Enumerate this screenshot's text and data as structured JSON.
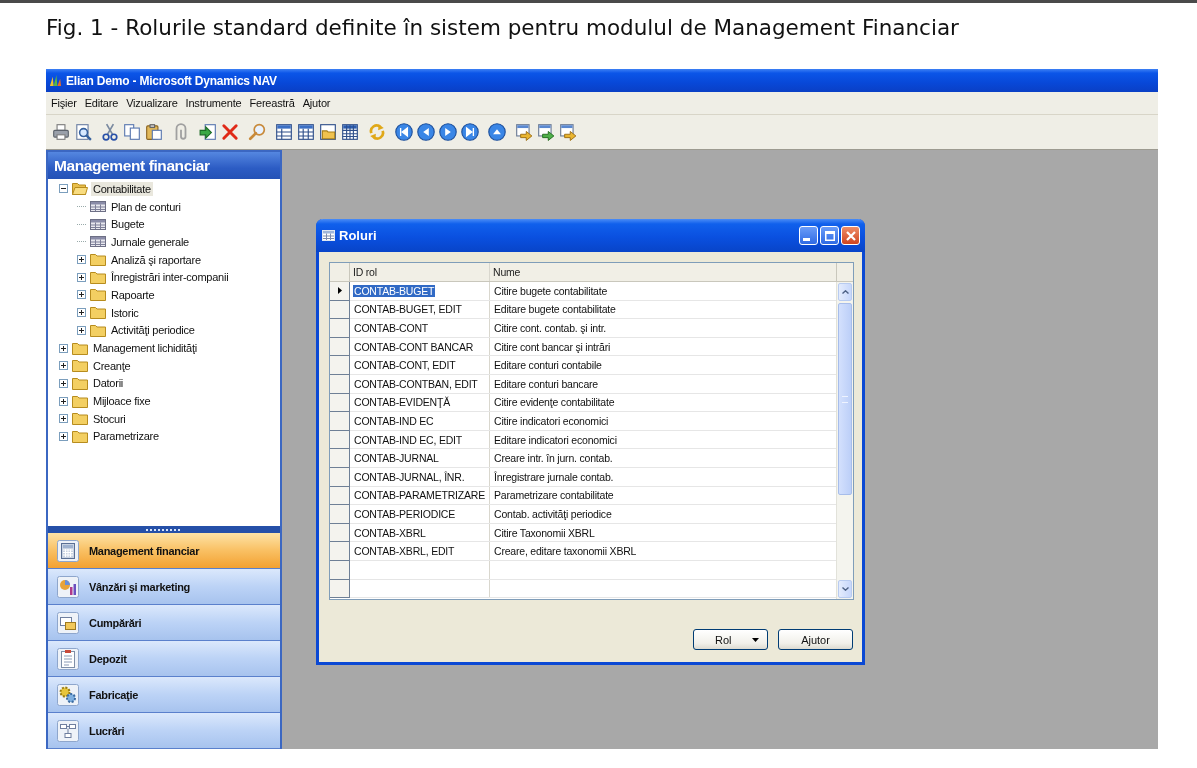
{
  "caption": "Fig. 1 - Rolurile standard definite în sistem pentru modulul de Management Financiar",
  "window": {
    "title": "Elian Demo - Microsoft Dynamics NAV"
  },
  "menu_bar": [
    "Fişier",
    "Editare",
    "Vizualizare",
    "Instrumente",
    "Fereastră",
    "Ajutor"
  ],
  "navigation_pane": {
    "title": "Management financiar",
    "tree": [
      {
        "label": "Contabilitate",
        "kind": "folder",
        "expanded": true,
        "selected": true,
        "children": [
          {
            "label": "Plan de conturi",
            "kind": "table",
            "expanded": false,
            "selected": false
          },
          {
            "label": "Bugete",
            "kind": "table",
            "expanded": false,
            "selected": false
          },
          {
            "label": "Jurnale generale",
            "kind": "table",
            "expanded": false,
            "selected": false
          },
          {
            "label": "Analiză şi raportare",
            "kind": "folder",
            "expanded": false,
            "selected": false
          },
          {
            "label": "Înregistrări inter-companii",
            "kind": "folder",
            "expanded": false,
            "selected": false
          },
          {
            "label": "Rapoarte",
            "kind": "folder",
            "expanded": false,
            "selected": false
          },
          {
            "label": "Istoric",
            "kind": "folder",
            "expanded": false,
            "selected": false
          },
          {
            "label": "Activităţi periodice",
            "kind": "folder",
            "expanded": false,
            "selected": false
          }
        ]
      },
      {
        "label": "Management lichidităţi",
        "kind": "folder",
        "expanded": false,
        "selected": false
      },
      {
        "label": "Creanţe",
        "kind": "folder",
        "expanded": false,
        "selected": false
      },
      {
        "label": "Datorii",
        "kind": "folder",
        "expanded": false,
        "selected": false
      },
      {
        "label": "Mijloace fixe",
        "kind": "folder",
        "expanded": false,
        "selected": false
      },
      {
        "label": "Stocuri",
        "kind": "folder",
        "expanded": false,
        "selected": false
      },
      {
        "label": "Parametrizare",
        "kind": "folder",
        "expanded": false,
        "selected": false
      }
    ],
    "buttons": [
      {
        "label": "Management financiar",
        "selected": true
      },
      {
        "label": "Vânzări şi marketing",
        "selected": false
      },
      {
        "label": "Cumpărări",
        "selected": false
      },
      {
        "label": "Depozit",
        "selected": false
      },
      {
        "label": "Fabricaţie",
        "selected": false
      },
      {
        "label": "Lucrări",
        "selected": false
      }
    ]
  },
  "dialog": {
    "title": "Roluri",
    "table": {
      "columns": [
        "ID rol",
        "Nume"
      ],
      "rows": [
        {
          "cells": [
            "CONTAB-BUGET",
            "Citire bugete contabilitate"
          ],
          "selected": true
        },
        {
          "cells": [
            "CONTAB-BUGET, EDIT",
            "Editare bugete contabilitate"
          ],
          "selected": false
        },
        {
          "cells": [
            "CONTAB-CONT",
            "Citire cont. contab. şi intr."
          ],
          "selected": false
        },
        {
          "cells": [
            "CONTAB-CONT BANCAR",
            "Citire cont bancar şi intrări"
          ],
          "selected": false
        },
        {
          "cells": [
            "CONTAB-CONT, EDIT",
            "Editare conturi contabile"
          ],
          "selected": false
        },
        {
          "cells": [
            "CONTAB-CONTBAN, EDIT",
            "Editare conturi bancare"
          ],
          "selected": false
        },
        {
          "cells": [
            "CONTAB-EVIDENŢĂ",
            "Citire evidenţe contabilitate"
          ],
          "selected": false
        },
        {
          "cells": [
            "CONTAB-IND EC",
            "Citire indicatori economici"
          ],
          "selected": false
        },
        {
          "cells": [
            "CONTAB-IND EC, EDIT",
            "Editare indicatori economici"
          ],
          "selected": false
        },
        {
          "cells": [
            "CONTAB-JURNAL",
            "Creare intr. în jurn. contab."
          ],
          "selected": false
        },
        {
          "cells": [
            "CONTAB-JURNAL, ÎNR.",
            "Înregistrare jurnale contab."
          ],
          "selected": false
        },
        {
          "cells": [
            "CONTAB-PARAMETRIZARE",
            "Parametrizare contabilitate"
          ],
          "selected": false
        },
        {
          "cells": [
            "CONTAB-PERIODICE",
            "Contab. activităţi periodice"
          ],
          "selected": false
        },
        {
          "cells": [
            "CONTAB-XBRL",
            "Citire Taxonomii XBRL"
          ],
          "selected": false
        },
        {
          "cells": [
            "CONTAB-XBRL, EDIT",
            "Creare, editare taxonomii XBRL"
          ],
          "selected": false
        }
      ]
    },
    "buttons": [
      {
        "label": "Rol",
        "kind": "menu"
      },
      {
        "label": "Ajutor",
        "kind": "help"
      }
    ]
  }
}
